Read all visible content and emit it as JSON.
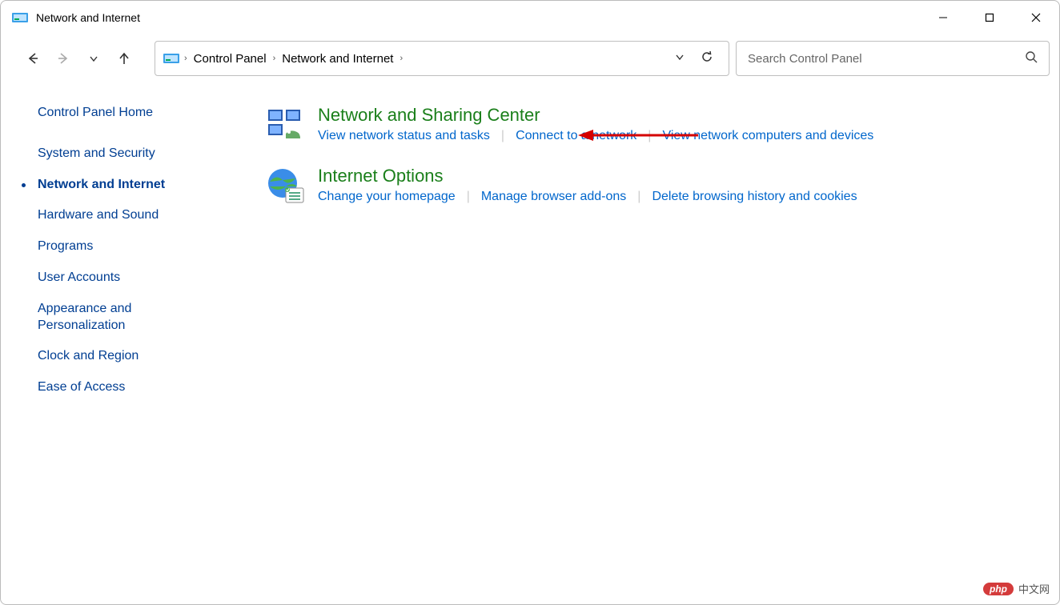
{
  "window": {
    "title": "Network and Internet"
  },
  "breadcrumb": {
    "items": [
      "Control Panel",
      "Network and Internet"
    ]
  },
  "search": {
    "placeholder": "Search Control Panel"
  },
  "sidebar": {
    "home": "Control Panel Home",
    "items": [
      "System and Security",
      "Network and Internet",
      "Hardware and Sound",
      "Programs",
      "User Accounts",
      "Appearance and Personalization",
      "Clock and Region",
      "Ease of Access"
    ],
    "active_index": 1
  },
  "categories": [
    {
      "title": "Network and Sharing Center",
      "links": [
        "View network status and tasks",
        "Connect to a network",
        "View network computers and devices"
      ]
    },
    {
      "title": "Internet Options",
      "links": [
        "Change your homepage",
        "Manage browser add-ons",
        "Delete browsing history and cookies"
      ]
    }
  ],
  "watermark": {
    "badge": "php",
    "text": "中文网"
  }
}
